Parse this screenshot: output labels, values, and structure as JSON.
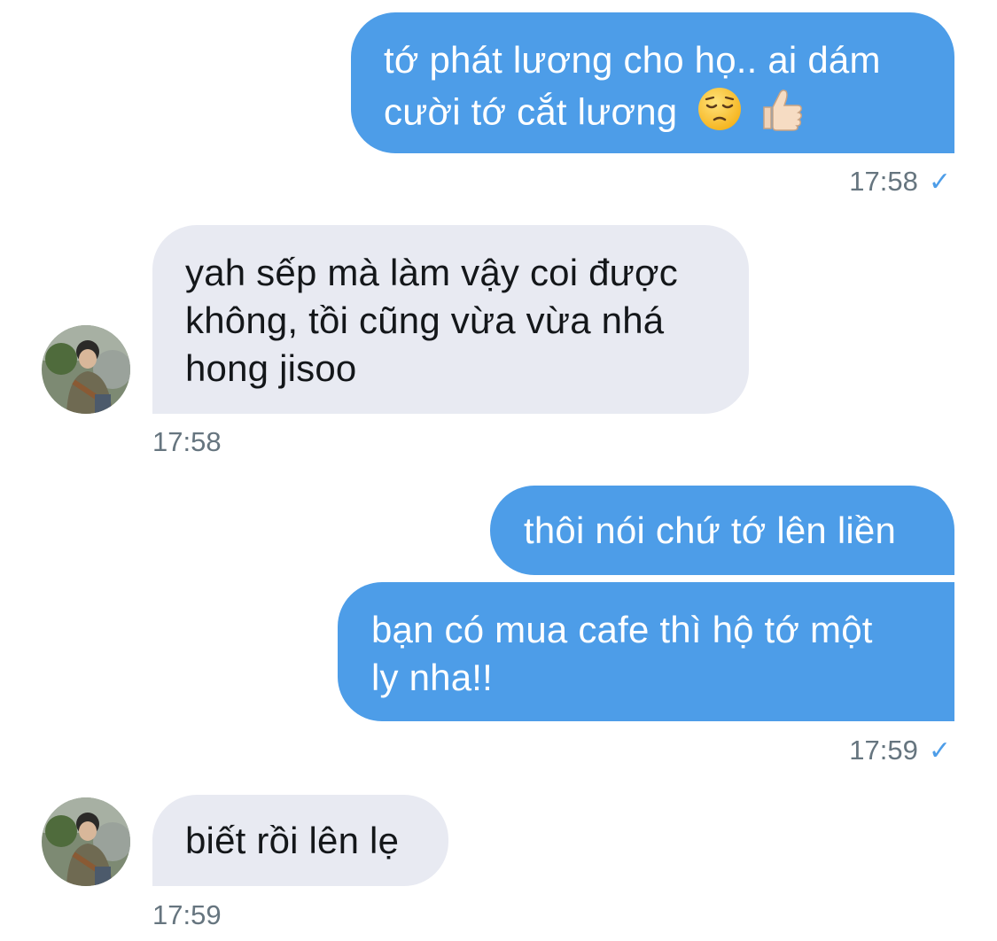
{
  "thread": {
    "messages": [
      {
        "direction": "outgoing",
        "text_line1": "tớ phát lương cho họ.. ai dám",
        "text_line2": "cười tớ cắt lương",
        "emojis": [
          "pensive-face",
          "thumbs-up-light-skin-tone"
        ],
        "time": "17:58",
        "status": "✓"
      },
      {
        "direction": "incoming",
        "text_line1": "yah sếp mà làm vậy coi được",
        "text_line2": "không, tồi cũng vừa vừa nhá",
        "text_line3": "hong jisoo",
        "time": "17:58"
      },
      {
        "direction": "outgoing",
        "text": "thôi nói chứ tớ lên liền"
      },
      {
        "direction": "outgoing",
        "text_line1": "bạn có mua cafe thì hộ tớ một",
        "text_line2": "ly nha!!",
        "time": "17:59",
        "status": "✓"
      },
      {
        "direction": "incoming",
        "text": "biết rồi lên lẹ",
        "time": "17:59"
      }
    ]
  },
  "colors": {
    "outgoing_bubble": "#4d9de8",
    "incoming_bubble": "#e8eaf2",
    "timestamp": "#66757f"
  }
}
